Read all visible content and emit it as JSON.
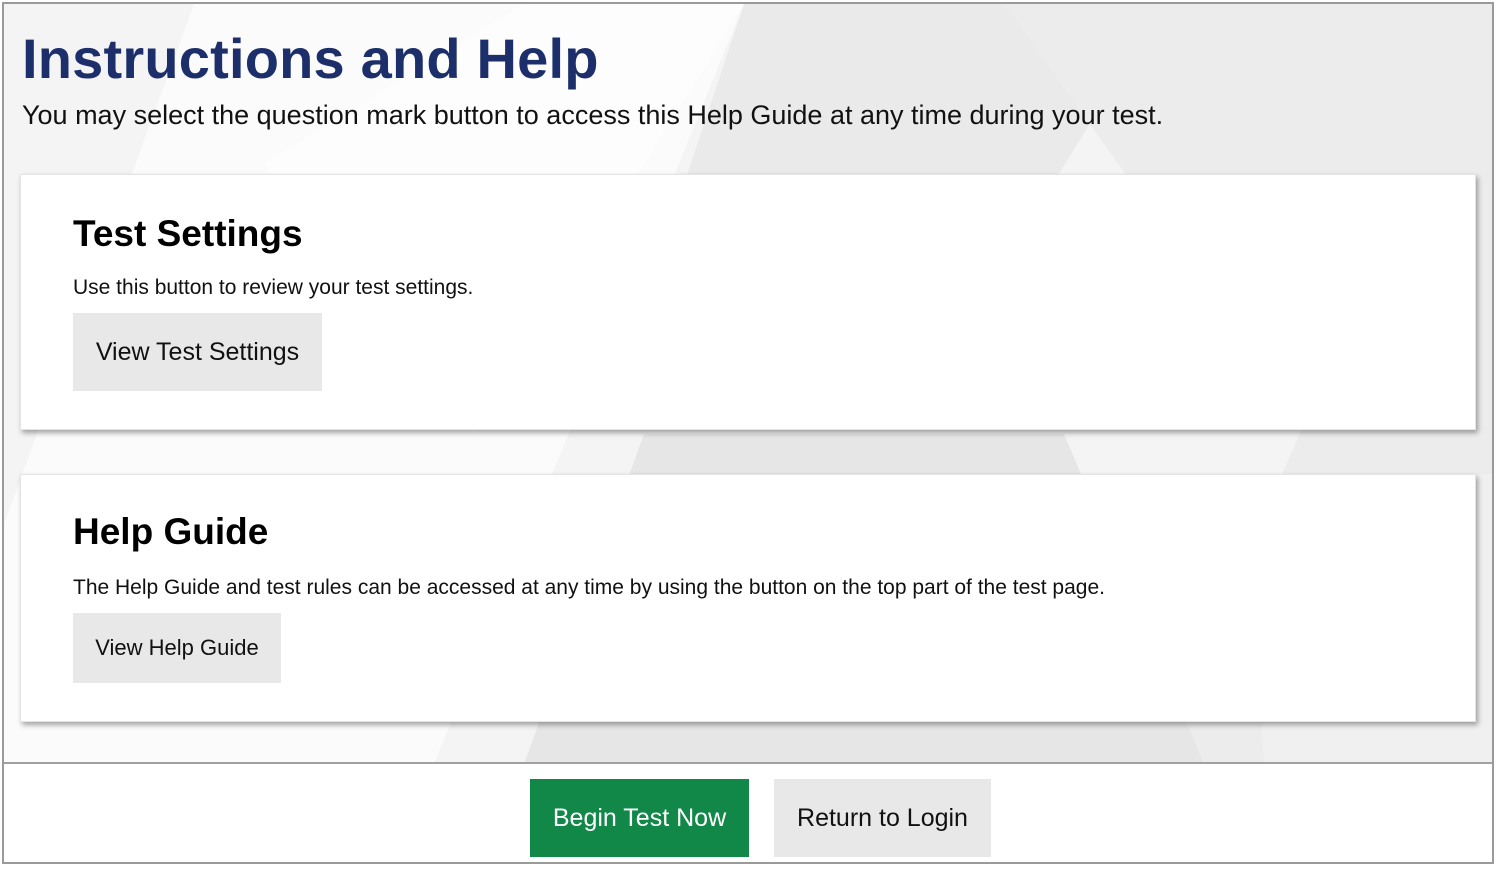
{
  "header": {
    "title": "Instructions and Help",
    "subtitle": "You may select the question mark button to access this Help Guide at any time during your test."
  },
  "settings_card": {
    "title": "Test Settings",
    "description": "Use this button to review your test settings.",
    "button_label": "View Test Settings"
  },
  "help_card": {
    "title": "Help Guide",
    "description": "The Help Guide and test rules can be accessed at any time by using the button on the top part of the test page.",
    "button_label": "View Help Guide"
  },
  "footer": {
    "begin_label": "Begin Test Now",
    "return_label": "Return to Login"
  },
  "colors": {
    "title": "#1c2f6b",
    "primary_button": "#128848",
    "secondary_button": "#e8e8e8"
  }
}
